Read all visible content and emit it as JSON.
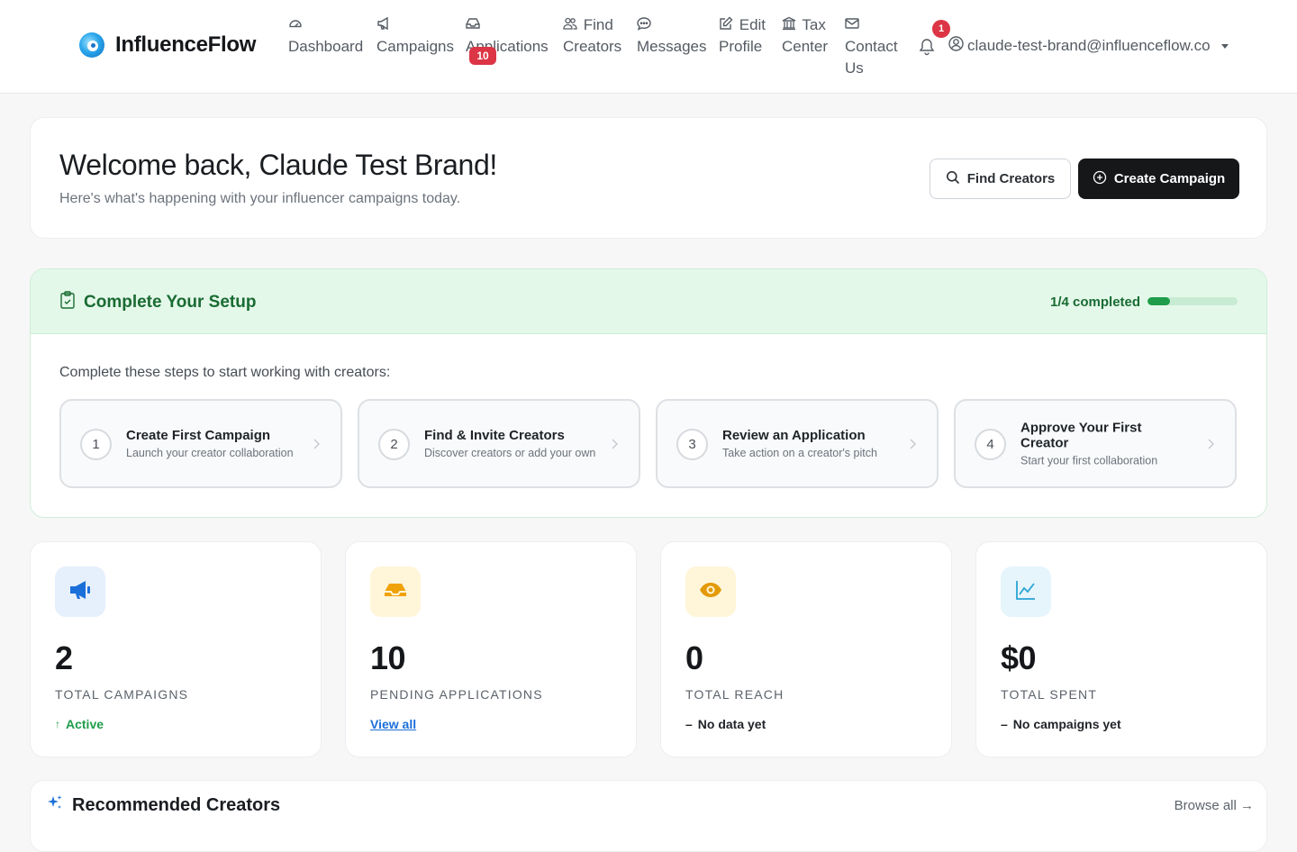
{
  "brand": {
    "name": "InfluenceFlow"
  },
  "nav": {
    "items": [
      {
        "line1": "Dashboard",
        "line2": "",
        "icon": "dashboard-icon"
      },
      {
        "line1": "Campaigns",
        "line2": "",
        "icon": "megaphone-icon"
      },
      {
        "line1": "Applications",
        "line2": "",
        "icon": "inbox-icon"
      },
      {
        "line1": "Find",
        "line2": "Creators",
        "icon": "people-icon"
      },
      {
        "line1": "Messages",
        "line2": "",
        "icon": "chat-icon"
      },
      {
        "line1": "Edit",
        "line2": "Profile",
        "icon": "edit-icon"
      },
      {
        "line1": "Tax",
        "line2": "Center",
        "icon": "bank-icon"
      },
      {
        "line1": "Contact",
        "line2": "Us",
        "icon": "envelope-icon"
      }
    ],
    "applications_badge": "10",
    "notifications_badge": "1",
    "user_email": "claude-test-brand@influenceflow.co"
  },
  "welcome": {
    "heading": "Welcome back, Claude Test Brand!",
    "subtitle": "Here's what's happening with your influencer campaigns today.",
    "find_creators_label": "Find Creators",
    "create_campaign_label": "Create Campaign"
  },
  "setup": {
    "title": "Complete Your Setup",
    "progress_label": "1/4 completed",
    "progress_fraction": 0.25,
    "intro": "Complete these steps to start working with creators:",
    "steps": [
      {
        "num": "1",
        "title": "Create First Campaign",
        "subtitle": "Launch your creator collaboration"
      },
      {
        "num": "2",
        "title": "Find & Invite Creators",
        "subtitle": "Discover creators or add your own"
      },
      {
        "num": "3",
        "title": "Review an Application",
        "subtitle": "Take action on a creator's pitch"
      },
      {
        "num": "4",
        "title": "Approve Your First Creator",
        "subtitle": "Start your first collaboration"
      }
    ]
  },
  "stats": [
    {
      "value": "2",
      "label": "TOTAL CAMPAIGNS",
      "foot": "Active",
      "foot_symbol": "↑",
      "icon": "megaphone-icon",
      "icon_bg": "#e6f0fd",
      "icon_color": "#1b6fd9",
      "foot_color": "#1f9d4a"
    },
    {
      "value": "10",
      "label": "PENDING APPLICATIONS",
      "foot": "View all",
      "foot_symbol": "",
      "icon": "inbox-icon",
      "icon_bg": "#fff5d9",
      "icon_color": "#f0a20a",
      "foot_color": "#1b6fd9"
    },
    {
      "value": "0",
      "label": "TOTAL REACH",
      "foot": "No data yet",
      "foot_symbol": "–",
      "icon": "eye-icon",
      "icon_bg": "#fff5d9",
      "icon_color": "#e39a07",
      "foot_color": "#1f2328"
    },
    {
      "value": "$0",
      "label": "TOTAL SPENT",
      "foot": "No campaigns yet",
      "foot_symbol": "–",
      "icon": "chart-line-icon",
      "icon_bg": "#e6f5fc",
      "icon_color": "#2aa3d4",
      "foot_color": "#1f2328"
    }
  ],
  "recommended": {
    "title": "Recommended Creators",
    "browse_label": "Browse all →"
  }
}
